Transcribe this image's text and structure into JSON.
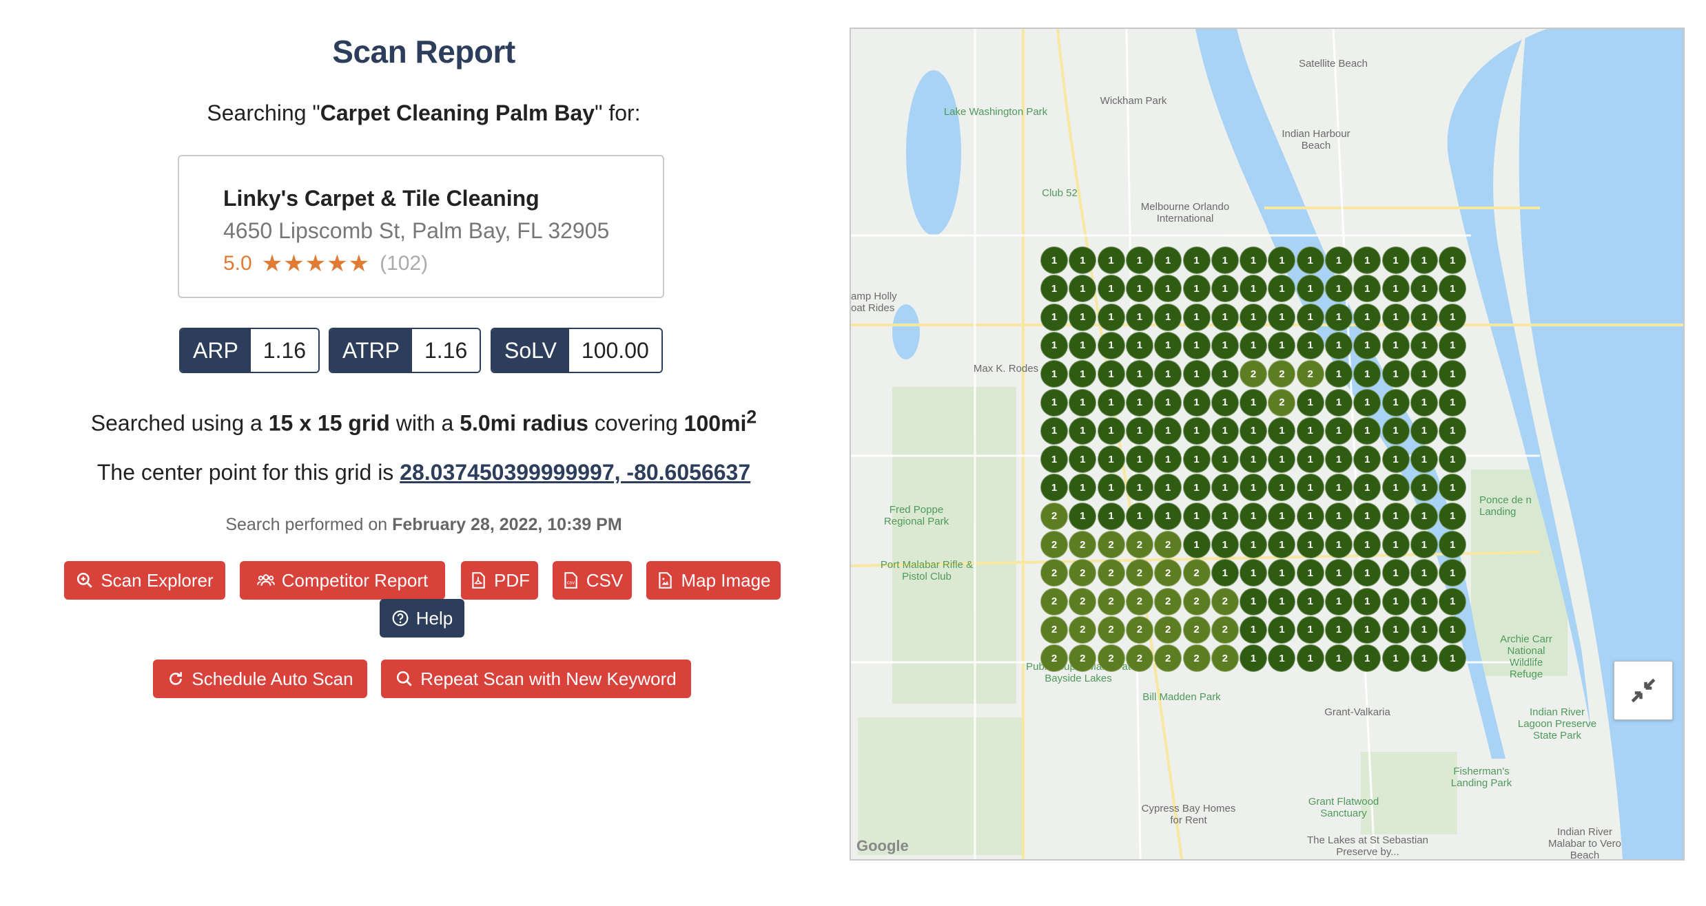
{
  "report": {
    "title": "Scan Report",
    "searching_prefix": "Searching \"",
    "keyword": "Carpet Cleaning Palm Bay",
    "searching_suffix": "\" for:"
  },
  "business": {
    "name": "Linky's Carpet & Tile Cleaning",
    "address": "4650 Lipscomb St, Palm Bay, FL 32905",
    "rating": "5.0",
    "stars": 5,
    "reviews": "(102)"
  },
  "metrics": [
    {
      "label": "ARP",
      "value": "1.16"
    },
    {
      "label": "ATRP",
      "value": "1.16"
    },
    {
      "label": "SoLV",
      "value": "100.00"
    }
  ],
  "grid_info": {
    "prefix": "Searched using a ",
    "grid": "15 x 15 grid",
    "middle": " with a ",
    "radius": "5.0mi radius",
    "covering": " covering ",
    "area": "100mi",
    "area_sup": "2"
  },
  "center": {
    "prefix": "The center point for this grid is ",
    "coords": "28.037450399999997, -80.6056637"
  },
  "performed": {
    "prefix": "Search performed on ",
    "date": "February 28, 2022, 10:39 PM"
  },
  "buttons": {
    "scan_explorer": "Scan Explorer",
    "competitor_report": "Competitor Report",
    "pdf": "PDF",
    "csv": "CSV",
    "map_image": "Map Image",
    "help": "Help",
    "schedule_auto_scan": "Schedule Auto Scan",
    "repeat_scan": "Repeat Scan with New Keyword"
  },
  "colors": {
    "rank_1": "#2f5b12",
    "rank_2": "#5d7d22",
    "navy": "#2c3e5c",
    "red": "#d9413b",
    "star": "#e07b35"
  },
  "map": {
    "labels": [
      "Satellite Beach",
      "Wickham Park",
      "Lake Washington Park",
      "Indian Harbour Beach",
      "Club 52",
      "Melbourne Orlando International",
      "amp Holly oat Rides",
      "Max K. Rodes",
      "Fred Poppe Regional Park",
      "Port Malabar Rifle & Pistol Club",
      "Ponce de n Landing",
      "Archie Carr National Wildlife Refuge",
      "Publix Super Market at Bayside Lakes",
      "Bill Madden Park",
      "Grant-Valkaria",
      "Indian River Lagoon Preserve State Park",
      "Fisherman's Landing Park",
      "Grant Flatwood Sanctuary",
      "Cypress Bay Homes for Rent",
      "The Lakes at St Sebastian Preserve by...",
      "Indian River Malabar to Vero Beach"
    ],
    "attribution": "Google",
    "grid_rows": [
      [
        1,
        1,
        1,
        1,
        1,
        1,
        1,
        1,
        1,
        1,
        1,
        1,
        1,
        1,
        1
      ],
      [
        1,
        1,
        1,
        1,
        1,
        1,
        1,
        1,
        1,
        1,
        1,
        1,
        1,
        1,
        1
      ],
      [
        1,
        1,
        1,
        1,
        1,
        1,
        1,
        1,
        1,
        1,
        1,
        1,
        1,
        1,
        1
      ],
      [
        1,
        1,
        1,
        1,
        1,
        1,
        1,
        1,
        1,
        1,
        1,
        1,
        1,
        1,
        1
      ],
      [
        1,
        1,
        1,
        1,
        1,
        1,
        1,
        2,
        2,
        2,
        1,
        1,
        1,
        1,
        1
      ],
      [
        1,
        1,
        1,
        1,
        1,
        1,
        1,
        1,
        2,
        1,
        1,
        1,
        1,
        1,
        1
      ],
      [
        1,
        1,
        1,
        1,
        1,
        1,
        1,
        1,
        1,
        1,
        1,
        1,
        1,
        1,
        1
      ],
      [
        1,
        1,
        1,
        1,
        1,
        1,
        1,
        1,
        1,
        1,
        1,
        1,
        1,
        1,
        1
      ],
      [
        1,
        1,
        1,
        1,
        1,
        1,
        1,
        1,
        1,
        1,
        1,
        1,
        1,
        1,
        1
      ],
      [
        2,
        1,
        1,
        1,
        1,
        1,
        1,
        1,
        1,
        1,
        1,
        1,
        1,
        1,
        1
      ],
      [
        2,
        2,
        2,
        2,
        2,
        1,
        1,
        1,
        1,
        1,
        1,
        1,
        1,
        1,
        1
      ],
      [
        2,
        2,
        2,
        2,
        2,
        2,
        1,
        1,
        1,
        1,
        1,
        1,
        1,
        1,
        1
      ],
      [
        2,
        2,
        2,
        2,
        2,
        2,
        2,
        1,
        1,
        1,
        1,
        1,
        1,
        1,
        1
      ],
      [
        2,
        2,
        2,
        2,
        2,
        2,
        2,
        1,
        1,
        1,
        1,
        1,
        1,
        1,
        1
      ],
      [
        2,
        2,
        2,
        2,
        2,
        2,
        2,
        1,
        1,
        1,
        1,
        1,
        1,
        1,
        1
      ]
    ]
  }
}
